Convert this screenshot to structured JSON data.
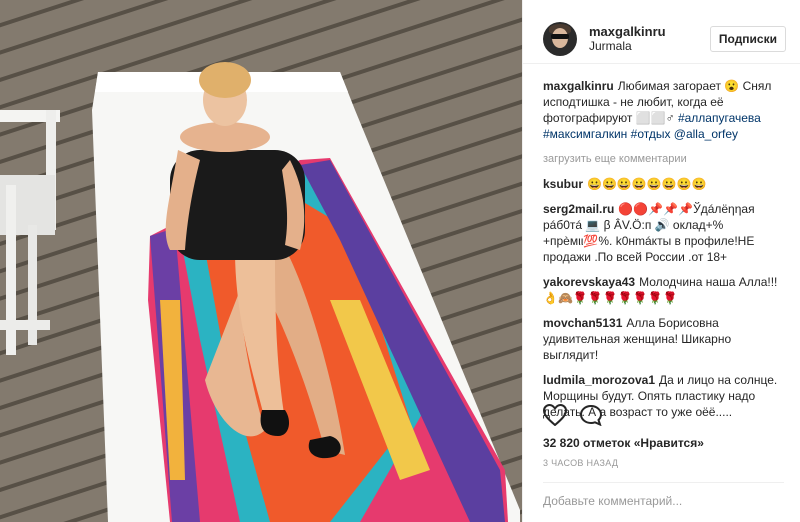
{
  "header": {
    "username": "maxgalkinru",
    "location": "Jurmala",
    "follow_label": "Подписки"
  },
  "caption": {
    "username": "maxgalkinru",
    "text": "Любимая загорает 😮 Снял исподтишка - не любит, когда её фотографируют ⬜⬜♂",
    "tags": "#аллапугачева #максимгалкин #отдых @alla_orfey"
  },
  "load_more": "загрузить еще комментарии",
  "comments": [
    {
      "username": "ksubur",
      "text": "😀😀😀😀😀😀😀😀"
    },
    {
      "username": "serg2mail.ru",
      "text": "🔴🔴📌📌📌Ўдáлёηηая рáб0тá 💻 β ÂV.Ö:п 🔊 оклад+% +прèмιι💯%. k0нmáкты в профиле!НЕ продажи .По всей России .от 18+"
    },
    {
      "username": "yakorevskaya43",
      "text": "Молодчина наша Алла!!! 👌🙈🌹🌹🌹🌹🌹🌹🌹"
    },
    {
      "username": "movchan5131",
      "text": "Алла Борисовна удивительная женщина! Шикарно выглядит!"
    },
    {
      "username": "ludmila_morozova1",
      "text": "Да и лицо на солнце. Морщины будут. Опять пластику надо делать. А а возраст то уже оёё....."
    }
  ],
  "likes_text": "32 820 отметок «Нравится»",
  "time_text": "3 ЧАСОВ НАЗАД",
  "add_comment_placeholder": "Добавьте комментарий...",
  "icons": {
    "like": "heart-icon",
    "comment": "comment-icon"
  }
}
